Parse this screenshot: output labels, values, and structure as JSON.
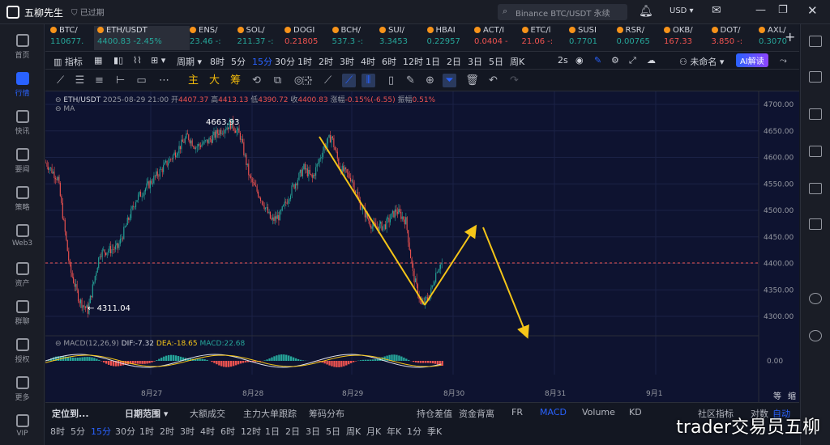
{
  "app": {
    "name": "五柳先生",
    "expired_label": "已过期",
    "search_placeholder": "Binance BTC/USDT 永续",
    "currency": "USD"
  },
  "nav": [
    {
      "label": "首页",
      "icon": "home-icon"
    },
    {
      "label": "行情",
      "icon": "bar-chart-icon",
      "active": true
    },
    {
      "label": "快讯",
      "icon": "news-icon"
    },
    {
      "label": "要闻",
      "icon": "document-icon"
    },
    {
      "label": "策略",
      "icon": "strategy-icon"
    },
    {
      "label": "Web3",
      "icon": "web3-icon"
    },
    {
      "label": "资产",
      "icon": "wallet-icon"
    },
    {
      "label": "群聊",
      "icon": "chat-icon"
    },
    {
      "label": "授权",
      "icon": "key-icon"
    },
    {
      "label": "更多",
      "icon": "more-icon"
    },
    {
      "label": "VIP",
      "icon": "diamond-icon"
    }
  ],
  "tickers": [
    {
      "name": "BTC/",
      "price": "110677.",
      "dir": "up"
    },
    {
      "name": "ETH/USDT",
      "price": "4400.83",
      "change": "-2.45%",
      "dir": "up",
      "active": true
    },
    {
      "name": "ENS/",
      "price": "23.46",
      "change": "-:",
      "dir": "up"
    },
    {
      "name": "SOL/",
      "price": "211.37",
      "change": "-:",
      "dir": "up"
    },
    {
      "name": "DOGI",
      "price": "0.21805",
      "dir": "dn"
    },
    {
      "name": "BCH/",
      "price": "537.3",
      "change": "-:",
      "dir": "up"
    },
    {
      "name": "SUI/",
      "price": "3.3453",
      "dir": "up"
    },
    {
      "name": "HBAI",
      "price": "0.22957",
      "dir": "up"
    },
    {
      "name": "ACT/I",
      "price": "0.0404",
      "change": "-",
      "dir": "dn"
    },
    {
      "name": "ETC/l",
      "price": "21.06",
      "change": "-:",
      "dir": "dn"
    },
    {
      "name": "SUSI",
      "price": "0.7701",
      "dir": "up"
    },
    {
      "name": "RSR/",
      "price": "0.00765",
      "dir": "up"
    },
    {
      "name": "OKB/",
      "price": "167.33",
      "dir": "dn"
    },
    {
      "name": "DOT/",
      "price": "3.850",
      "change": "-:",
      "dir": "dn"
    },
    {
      "name": "AXL/",
      "price": "0.3070",
      "dir": "up"
    }
  ],
  "toolbar1": {
    "indicators": "指标",
    "period": "周期",
    "timeframes": [
      "8时",
      "5分",
      "15分",
      "30分",
      "1时",
      "2时",
      "3时",
      "4时",
      "6时",
      "12时",
      "1日",
      "2日",
      "3日",
      "5日",
      "周K"
    ],
    "selected_tf": "15分",
    "right": [
      "2s",
      "未命名",
      "AI解读"
    ]
  },
  "toolbar2": {
    "zh_tools": [
      "主",
      "大",
      "筹"
    ]
  },
  "legend": {
    "symbol": "ETH/USDT",
    "datetime": "2025-08-29 21:00",
    "open_label": "开",
    "open": "4407.37",
    "high_label": "高",
    "high": "4413.13",
    "low_label": "低",
    "low": "4390.72",
    "close_label": "收",
    "close": "4400.83",
    "chg_label": "涨幅",
    "chg": "-0.15%(-6.55)",
    "amp_label": "振幅",
    "amp": "0.51%",
    "ma": "MA"
  },
  "price_axis": [
    "4700.00",
    "4650.00",
    "4600.00",
    "4550.00",
    "4500.00",
    "4450.00",
    "4400.00",
    "4350.00",
    "4300.00"
  ],
  "annotations": {
    "high": "4663.93",
    "low": "4311.04"
  },
  "macd": {
    "label": "MACD(12,26,9)",
    "dif": "DIF:-7.32",
    "dea": "DEA:-18.65",
    "macd": "MACD:22.68",
    "zero": "0.00"
  },
  "time_axis": [
    "8月27",
    "8月28",
    "8月29",
    "8月30",
    "8月31",
    "9月1"
  ],
  "bottom_tabs": {
    "left": [
      "定位到...",
      "日期范围"
    ],
    "items": [
      "大额成交",
      "主力大单跟踪",
      "筹码分布",
      "持仓差值",
      "资金背离",
      "FR",
      "MACD",
      "Volume",
      "KD"
    ],
    "selected": "MACD",
    "right": [
      "社区指标",
      "对数",
      "自动"
    ]
  },
  "bottom_tf": [
    "8时",
    "5分",
    "15分",
    "30分",
    "1时",
    "2时",
    "3时",
    "4时",
    "6时",
    "12时",
    "1日",
    "2日",
    "3日",
    "5日",
    "周K",
    "月K",
    "年K",
    "1分",
    "季K"
  ],
  "bottom_tf_selected": "15分",
  "scale_labels": [
    "等",
    "缩"
  ],
  "watermark": "trader交易员五柳",
  "colors": {
    "up": "#26a69a",
    "down": "#ef5350",
    "accent": "#2962ff",
    "arrow": "#f5c518",
    "bg": "#0e1330"
  }
}
